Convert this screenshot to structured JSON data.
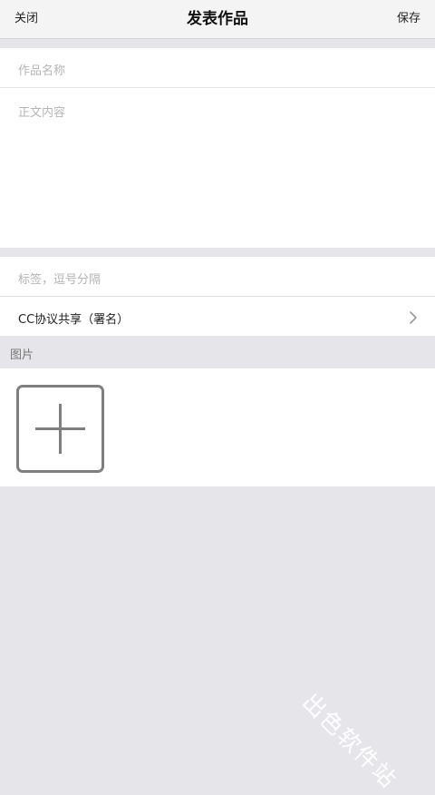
{
  "navbar": {
    "close_label": "关闭",
    "title": "发表作品",
    "save_label": "保存"
  },
  "editor": {
    "title_placeholder": "作品名称",
    "body_placeholder": "正文内容"
  },
  "meta": {
    "tags_placeholder": "标签，逗号分隔",
    "license_label": "CC协议共享（署名）",
    "license_chevron_icon": "chevron-right-icon"
  },
  "images": {
    "section_label": "图片",
    "add_icon": "plus-icon"
  },
  "watermark": {
    "text": "出色软件站"
  }
}
